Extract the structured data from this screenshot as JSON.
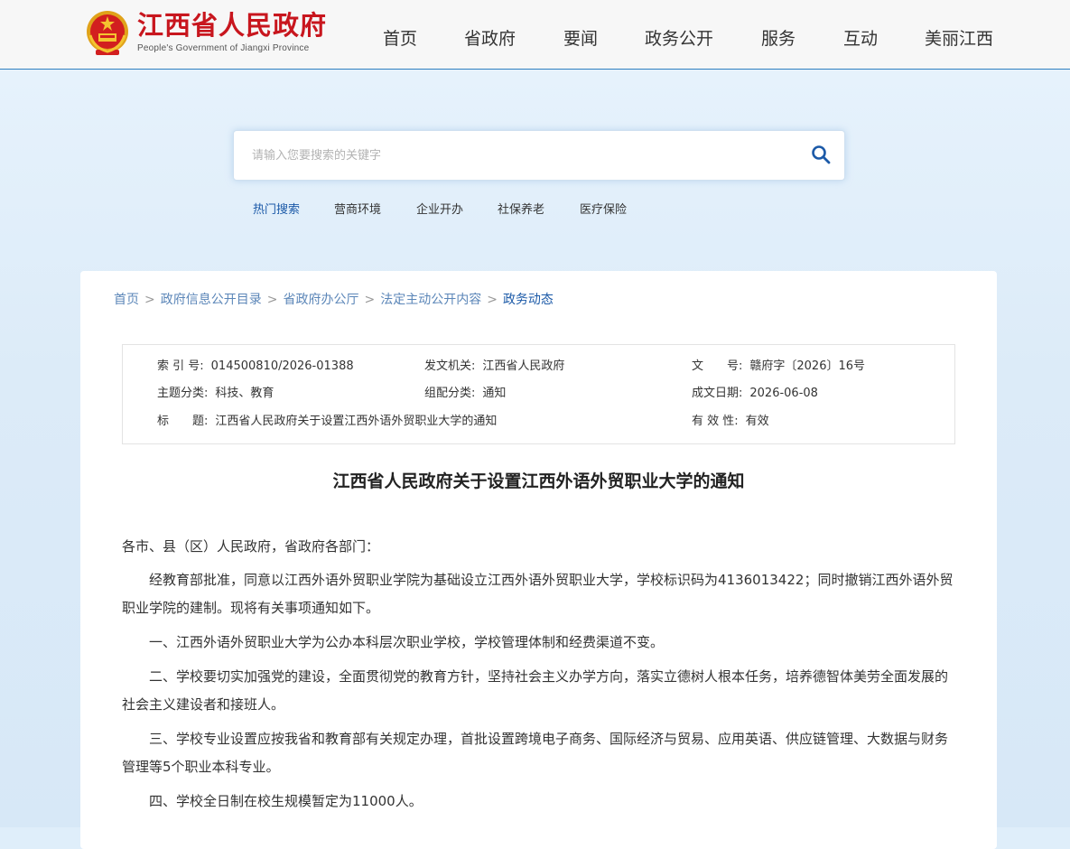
{
  "header": {
    "logo_cn": "江西省人民政府",
    "logo_en": "People's Government of Jiangxi Province",
    "nav": [
      "首页",
      "省政府",
      "要闻",
      "政务公开",
      "服务",
      "互动",
      "美丽江西"
    ]
  },
  "search": {
    "placeholder": "请输入您要搜索的关键字",
    "hot": [
      "热门搜索",
      "营商环境",
      "企业开办",
      "社保养老",
      "医疗保险"
    ]
  },
  "breadcrumb": {
    "links": [
      "首页",
      "政府信息公开目录",
      "省政府办公厅",
      "法定主动公开内容"
    ],
    "current": "政务动态",
    "sep": ">"
  },
  "meta": {
    "index_label": "索 引 号:",
    "index_value": "014500810/2026-01388",
    "issuer_label": "发文机关:",
    "issuer_value": "江西省人民政府",
    "docno_label": "文　　号:",
    "docno_value": "赣府字〔2026〕16号",
    "topic_label": "主题分类:",
    "topic_value": "科技、教育",
    "type_label": "组配分类:",
    "type_value": "通知",
    "date_label": "成文日期:",
    "date_value": "2026-06-08",
    "title_label": "标　　题:",
    "title_value": "江西省人民政府关于设置江西外语外贸职业大学的通知",
    "validity_label": "有 效 性:",
    "validity_value": "有效"
  },
  "doc": {
    "title": "江西省人民政府关于设置江西外语外贸职业大学的通知",
    "salutation": "各市、县（区）人民政府，省政府各部门：",
    "paragraphs": [
      "经教育部批准，同意以江西外语外贸职业学院为基础设立江西外语外贸职业大学，学校标识码为4136013422；同时撤销江西外语外贸职业学院的建制。现将有关事项通知如下。",
      "一、江西外语外贸职业大学为公办本科层次职业学校，学校管理体制和经费渠道不变。",
      "二、学校要切实加强党的建设，全面贯彻党的教育方针，坚持社会主义办学方向，落实立德树人根本任务，培养德智体美劳全面发展的社会主义建设者和接班人。",
      "三、学校专业设置应按我省和教育部有关规定办理，首批设置跨境电子商务、国际经济与贸易、应用英语、供应链管理、大数据与财务管理等5个职业本科专业。",
      "四、学校全日制在校生规模暂定为11000人。"
    ]
  },
  "colors": {
    "brand_red": "#c8161e",
    "link_blue": "#1c5aa8",
    "breadcrumb_blue": "#5b86b8"
  },
  "icons": {
    "emblem": "national-emblem-icon",
    "search": "search-icon"
  }
}
